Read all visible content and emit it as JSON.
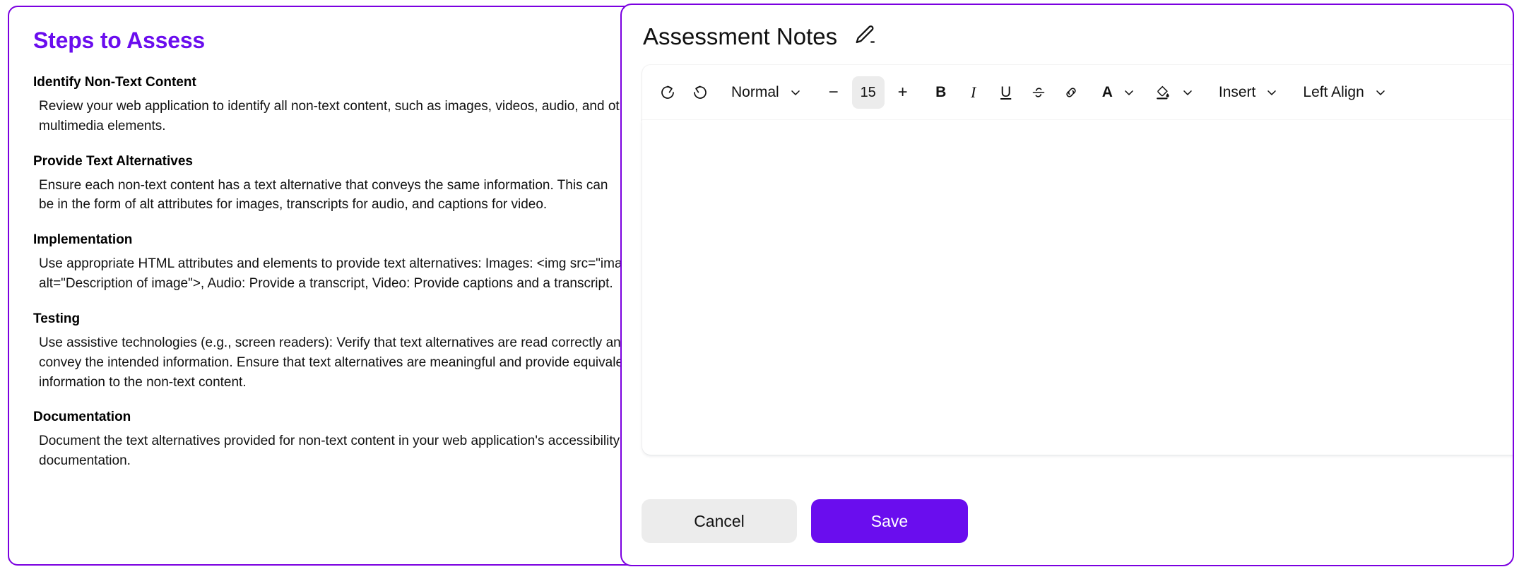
{
  "steps_panel": {
    "title": "Steps to Assess",
    "accent_color": "#6A0DEE",
    "border_color": "#7B00E0",
    "steps": [
      {
        "heading": "Identify Non-Text Content",
        "body": "Review your web application to identify all non-text content, such as images, videos, audio, and other\nmultimedia elements."
      },
      {
        "heading": "Provide Text Alternatives",
        "body": "Ensure each non-text content has a text alternative that conveys the same information. This can\nbe in the form of alt attributes for images, transcripts for audio, and captions for video."
      },
      {
        "heading": "Implementation",
        "body": "Use appropriate HTML attributes and elements to provide text alternatives: Images: <img src=\"image.jpg\"\nalt=\"Description of image\">, Audio: Provide a transcript, Video: Provide captions and a transcript."
      },
      {
        "heading": "Testing",
        "body": "Use assistive technologies (e.g., screen readers): Verify that text alternatives are read correctly and\nconvey the intended information. Ensure that text alternatives are meaningful and provide equivalent\ninformation to the non-text content."
      },
      {
        "heading": "Documentation",
        "body": "Document the text alternatives provided for non-text content in your web application's accessibility\ndocumentation."
      }
    ]
  },
  "notes_panel": {
    "title": "Assessment Notes",
    "edit_icon": "pencil-icon",
    "border_color": "#7B00E0",
    "toolbar": {
      "undo": "undo-icon",
      "redo": "redo-icon",
      "style_label": "Normal",
      "decrease_font": "−",
      "font_size": "15",
      "increase_font": "+",
      "bold": "B",
      "italic": "I",
      "underline": "U",
      "strikethrough": "S",
      "link": "link-icon",
      "text_color": "A",
      "highlight_color": "fill-bucket-icon",
      "insert_label": "Insert",
      "align_label": "Left Align"
    },
    "textarea": {
      "value": "",
      "placeholder": ""
    },
    "footer": {
      "cancel_label": "Cancel",
      "save_label": "Save",
      "save_color": "#6A0DEE",
      "cancel_color": "#ECECEC"
    }
  }
}
